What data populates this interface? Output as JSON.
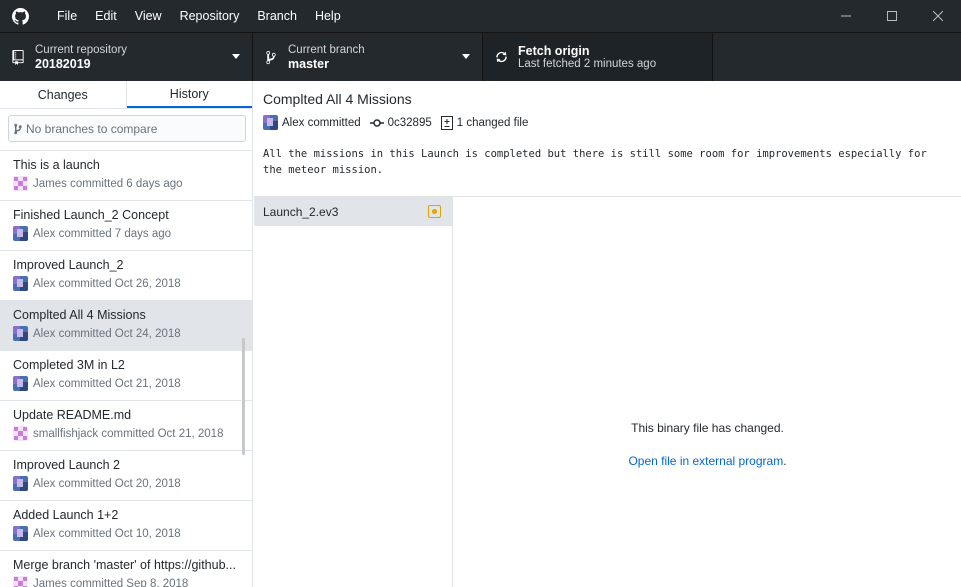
{
  "menu": [
    "File",
    "Edit",
    "View",
    "Repository",
    "Branch",
    "Help"
  ],
  "toolbar": {
    "repo": {
      "label": "Current repository",
      "value": "20182019"
    },
    "branch": {
      "label": "Current branch",
      "value": "master"
    },
    "fetch": {
      "label": "Fetch origin",
      "sub": "Last fetched 2 minutes ago"
    }
  },
  "tabs": {
    "changes": "Changes",
    "history": "History",
    "active": "History"
  },
  "compare": {
    "placeholder": "No branches to compare"
  },
  "commits": [
    {
      "summary": "This is a launch",
      "author": "James",
      "when": "James committed 6 days ago",
      "avatar": "pink"
    },
    {
      "summary": "Finished Launch_2 Concept",
      "author": "Alex",
      "when": "Alex committed 7 days ago",
      "avatar": "alex"
    },
    {
      "summary": "Improved Launch_2",
      "author": "Alex",
      "when": "Alex committed Oct 26, 2018",
      "avatar": "alex"
    },
    {
      "summary": "Complted All 4 Missions",
      "author": "Alex",
      "when": "Alex committed Oct 24, 2018",
      "avatar": "alex",
      "selected": true
    },
    {
      "summary": "Completed 3M in L2",
      "author": "Alex",
      "when": "Alex committed Oct 21, 2018",
      "avatar": "alex"
    },
    {
      "summary": "Update README.md",
      "author": "smallfishjack",
      "when": "smallfishjack committed Oct 21, 2018",
      "avatar": "pink"
    },
    {
      "summary": "Improved Launch 2",
      "author": "Alex",
      "when": "Alex committed Oct 20, 2018",
      "avatar": "alex"
    },
    {
      "summary": "Added Launch 1+2",
      "author": "Alex",
      "when": "Alex committed Oct 10, 2018",
      "avatar": "alex"
    },
    {
      "summary": "Merge branch 'master' of https://github...",
      "author": "James",
      "when": "James committed Sep 8, 2018",
      "avatar": "pink"
    }
  ],
  "commit_detail": {
    "title": "Complted All 4 Missions",
    "author_line": "Alex committed",
    "sha": "0c32895",
    "changed": "1 changed file",
    "body": "All the missions in this Launch is completed but there is still some room for improvements especially for the meteor mission."
  },
  "files": [
    {
      "name": "Launch_2.ev3",
      "status": "modified"
    }
  ],
  "diff": {
    "message": "This binary file has changed.",
    "link": "Open file in external program",
    "link_suffix": "."
  },
  "colors": {
    "toolbar_bg": "#24292e",
    "accent": "#0366d6",
    "modified": "#e5a200"
  }
}
